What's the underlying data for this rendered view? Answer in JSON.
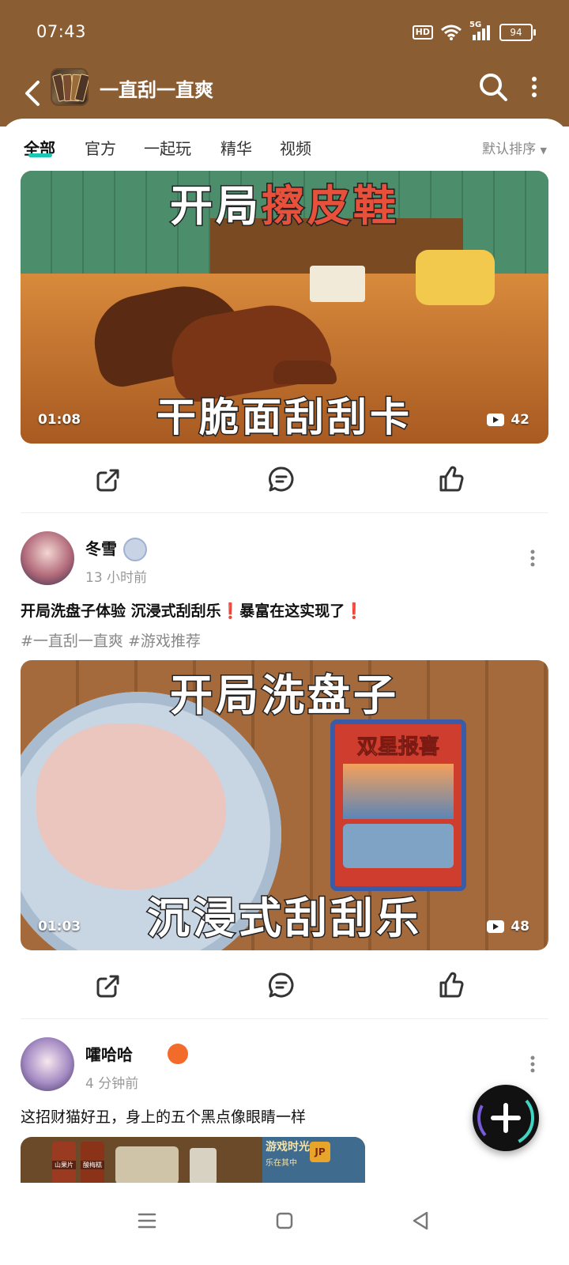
{
  "status_bar": {
    "time": "07:43",
    "hd": "HD",
    "network": "5G",
    "battery": "94"
  },
  "header": {
    "title": "一直刮一直爽"
  },
  "tabs": [
    {
      "label": "全部",
      "active": true
    },
    {
      "label": "官方",
      "active": false
    },
    {
      "label": "一起玩",
      "active": false
    },
    {
      "label": "精华",
      "active": false
    },
    {
      "label": "视频",
      "active": false
    }
  ],
  "sort": {
    "label": "默认排序"
  },
  "posts": [
    {
      "video": {
        "title_top_a": "开局",
        "title_top_b": "擦皮鞋",
        "title_bottom": "干脆面刮刮卡",
        "duration": "01:08",
        "views": "42"
      }
    },
    {
      "author": "冬雪",
      "time": "13 小时前",
      "text": "开局洗盘子体验 沉浸式刮刮乐❗️暴富在这实现了❗️",
      "tags": "#一直刮一直爽 #游戏推荐",
      "video": {
        "title_top": "开局洗盘子",
        "card_title": "双星报喜",
        "title_bottom": "沉浸式刮刮乐",
        "duration": "01:03",
        "views": "48"
      }
    },
    {
      "author": "嚯哈哈",
      "time": "4 分钟前",
      "text": "这招财猫好丑，身上的五个黑点像眼睛一样",
      "image_labels": [
        "山果片",
        "酸梅糕",
        "游戏时光",
        "乐在其中",
        "JP"
      ]
    }
  ],
  "colors": {
    "header_bg": "#8b5d33",
    "tab_accent": "#1cc7b1"
  }
}
